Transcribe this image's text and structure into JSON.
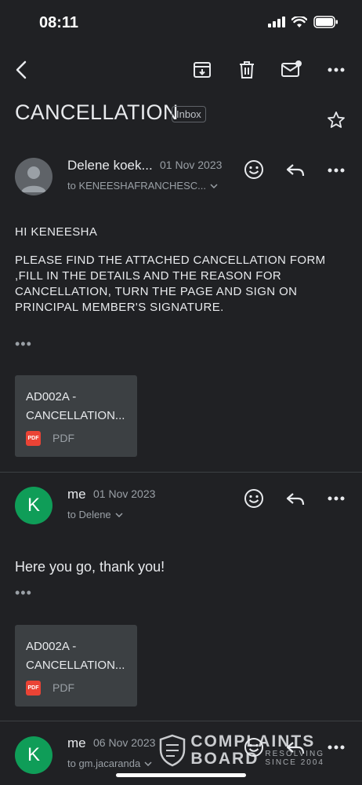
{
  "status": {
    "time": "08:11"
  },
  "email": {
    "subject": "CANCELLATION",
    "label": "Inbox"
  },
  "messages": [
    {
      "sender": "Delene koek...",
      "date": "01 Nov 2023",
      "recipient": "to KENEESHAFRANCHESC...",
      "greeting": "HI KENEESHA",
      "body": " PLEASE FIND THE ATTACHED CANCELLATION FORM ,FILL IN THE DETAILS AND THE REASON FOR CANCELLATION, TURN THE PAGE AND SIGN ON PRINCIPAL MEMBER'S SIGNATURE.",
      "more": "•••",
      "attachment": {
        "name_line1": "AD002A -",
        "name_line2": "CANCELLATION...",
        "type": "PDF",
        "badge": "PDF"
      }
    },
    {
      "avatar_letter": "K",
      "sender": "me",
      "date": "01 Nov 2023",
      "recipient": "to Delene",
      "body": "Here you go, thank you!",
      "more": "•••",
      "attachment": {
        "name_line1": "AD002A -",
        "name_line2": "CANCELLATION...",
        "type": "PDF",
        "badge": "PDF"
      }
    },
    {
      "avatar_letter": "K",
      "sender": "me",
      "date": "06 Nov 2023",
      "recipient": "to gm.jacaranda"
    }
  ],
  "watermark": {
    "line1": "COMPLAINTS",
    "line2": "BOARD",
    "sub1": "RESOLVING",
    "sub2": "SINCE 2004"
  }
}
